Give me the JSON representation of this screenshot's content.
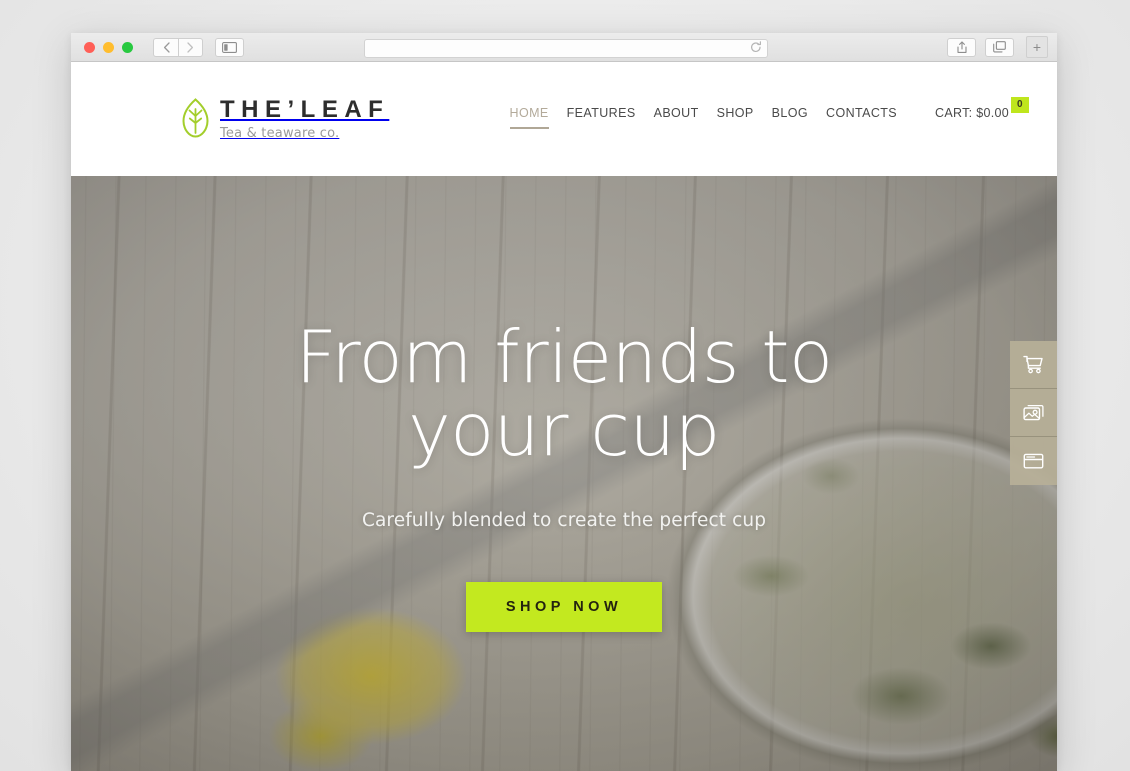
{
  "browser": {
    "traffic_lights": [
      "close",
      "minimize",
      "maximize"
    ],
    "back_label": "‹",
    "forward_label": "›",
    "sidebar_icon": "sidebar-icon",
    "url_value": "",
    "url_placeholder": "",
    "reload_icon": "reload-icon",
    "share_icon": "share-icon",
    "tabs_icon": "tabs-overview-icon",
    "new_tab_label": "+"
  },
  "site": {
    "brand": {
      "name": "THE’LEAF",
      "tagline": "Tea & teaware co.",
      "logo_icon": "leaf-icon",
      "logo_color": "#a3ce2b"
    },
    "nav": [
      {
        "label": "HOME",
        "active": true
      },
      {
        "label": "FEATURES",
        "active": false
      },
      {
        "label": "ABOUT",
        "active": false
      },
      {
        "label": "SHOP",
        "active": false
      },
      {
        "label": "BLOG",
        "active": false
      },
      {
        "label": "CONTACTS",
        "active": false
      }
    ],
    "cart": {
      "label": "CART: $0.00",
      "badge_count": "0",
      "badge_color": "#bfe61d"
    },
    "hero": {
      "title": "From friends to your cup",
      "subtitle": "Carefully blended to create the perfect cup",
      "button_label": "SHOP NOW",
      "button_color": "#c3e91f",
      "image_description": "Glass bowl of green tea leaves steeping in water on weathered white wood with a lemon wedge and a spoon"
    },
    "side_widgets": [
      {
        "icon": "shopping-cart-icon",
        "name": "cart-widget"
      },
      {
        "icon": "image-gallery-icon",
        "name": "gallery-widget"
      },
      {
        "icon": "browser-window-icon",
        "name": "layout-widget"
      }
    ],
    "accent_color": "#b0a796"
  }
}
